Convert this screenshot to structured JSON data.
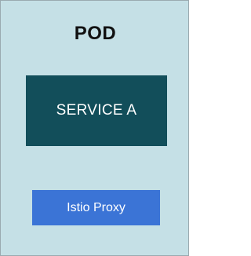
{
  "pod": {
    "title": "POD"
  },
  "service": {
    "label": "SERVICE A"
  },
  "proxy": {
    "label": "Istio Proxy"
  },
  "colors": {
    "pod_background": "#c5e0e6",
    "service_background": "#124e5a",
    "proxy_background": "#3b74d6",
    "label_text": "#ffffff",
    "title_text": "#111111"
  }
}
